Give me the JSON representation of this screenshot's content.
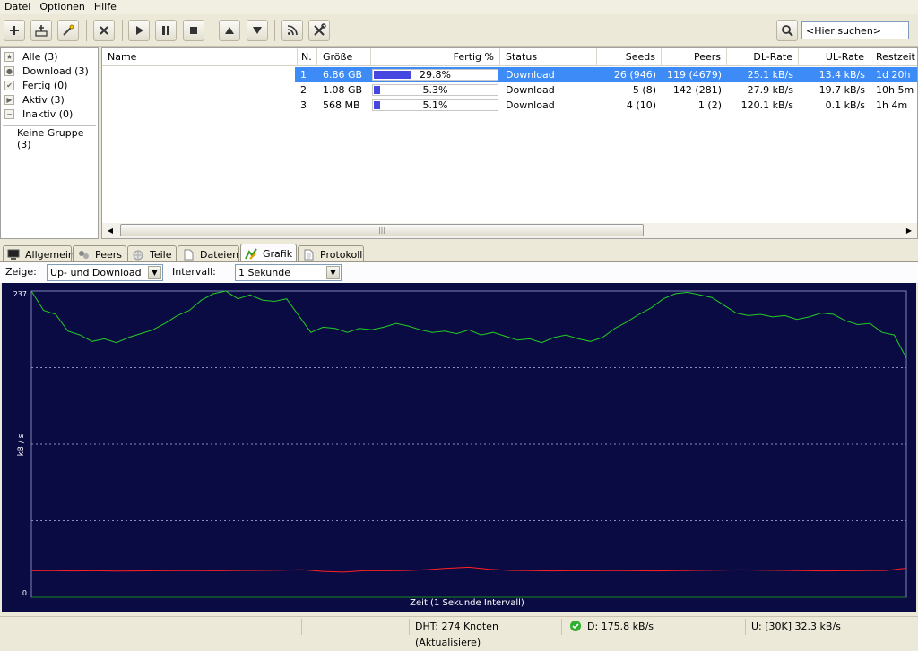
{
  "menu": [
    "Datei",
    "Optionen",
    "Hilfe"
  ],
  "toolbar": {
    "search_placeholder": "<Hier suchen>"
  },
  "filters": [
    {
      "label": "Alle (3)",
      "icon": "star-icon"
    },
    {
      "label": "Download (3)",
      "icon": "download-icon"
    },
    {
      "label": "Fertig (0)",
      "icon": "check-icon"
    },
    {
      "label": "Aktiv (3)",
      "icon": "play-icon"
    },
    {
      "label": "Inaktiv (0)",
      "icon": "minus-icon"
    }
  ],
  "group": "Keine Gruppe (3)",
  "table": {
    "headers": [
      "Name",
      "N.",
      "Größe",
      "Fertig %",
      "Status",
      "Seeds",
      "Peers",
      "DL-Rate",
      "UL-Rate",
      "Restzeit"
    ],
    "rows": [
      {
        "n": "1",
        "size": "6.86 GB",
        "progress": 29.8,
        "progress_label": "29.8%",
        "status": "Download",
        "seeds": "26 (946)",
        "peers": "119 (4679)",
        "dl": "25.1 kB/s",
        "ul": "13.4 kB/s",
        "eta": "1d 20h",
        "selected": true
      },
      {
        "n": "2",
        "size": "1.08 GB",
        "progress": 5.3,
        "progress_label": "5.3%",
        "status": "Download",
        "seeds": "5 (8)",
        "peers": "142 (281)",
        "dl": "27.9 kB/s",
        "ul": "19.7 kB/s",
        "eta": "10h 5m",
        "selected": false
      },
      {
        "n": "3",
        "size": "568 MB",
        "progress": 5.1,
        "progress_label": "5.1%",
        "status": "Download",
        "seeds": "4 (10)",
        "peers": "1 (2)",
        "dl": "120.1 kB/s",
        "ul": "0.1 kB/s",
        "eta": "1h 4m",
        "selected": false
      }
    ]
  },
  "tabs": [
    "Allgemein",
    "Peers",
    "Teile",
    "Dateien",
    "Grafik",
    "Protokoll"
  ],
  "active_tab": "Grafik",
  "controls": {
    "show_label": "Zeige:",
    "show_value": "Up- und Download",
    "interval_label": "Intervall:",
    "interval_value": "1 Sekunde"
  },
  "chart_data": {
    "type": "line",
    "ylabel": "kB / s",
    "xlabel": "Zeit (1 Sekunde Intervall)",
    "ylim": [
      0,
      237
    ],
    "yticks": [
      "237",
      "0"
    ],
    "grid": true,
    "series": [
      {
        "color": "#22cc22",
        "values": [
          237,
          222,
          219,
          206,
          203,
          198,
          200,
          197,
          201,
          204,
          207,
          212,
          218,
          222,
          230,
          235,
          237,
          231,
          234,
          230,
          229,
          231,
          218,
          205,
          209,
          208,
          205,
          208,
          207,
          209,
          212,
          210,
          207,
          205,
          206,
          204,
          207,
          203,
          205,
          202,
          199,
          200,
          197,
          201,
          203,
          200,
          198,
          201,
          208,
          213,
          219,
          224,
          231,
          235,
          236,
          234,
          232,
          226,
          220,
          218,
          219,
          217,
          218,
          215,
          217,
          220,
          219,
          214,
          211,
          212,
          205,
          203,
          185
        ]
      },
      {
        "color": "#ff2020",
        "values": [
          20.5,
          20.6,
          20.4,
          20.5,
          20.3,
          20.4,
          20.5,
          20.6,
          20.6,
          20.5,
          20.7,
          20.8,
          21,
          21.3,
          20,
          19.5,
          20.6,
          20.5,
          20.7,
          21.4,
          22.5,
          23.3,
          21.6,
          20.8,
          20.6,
          20.4,
          20.5,
          20.5,
          20.7,
          20.5,
          20.4,
          20.6,
          20.8,
          21,
          21.2,
          20.9,
          20.8,
          20.6,
          20.4,
          20.5,
          20.6,
          20.7,
          22.5
        ]
      }
    ]
  },
  "status": {
    "dht": "DHT: 274 Knoten (Aktualisiere)",
    "down": "D: 175.8 kB/s",
    "up": "U: [30K] 32.3 kB/s"
  }
}
